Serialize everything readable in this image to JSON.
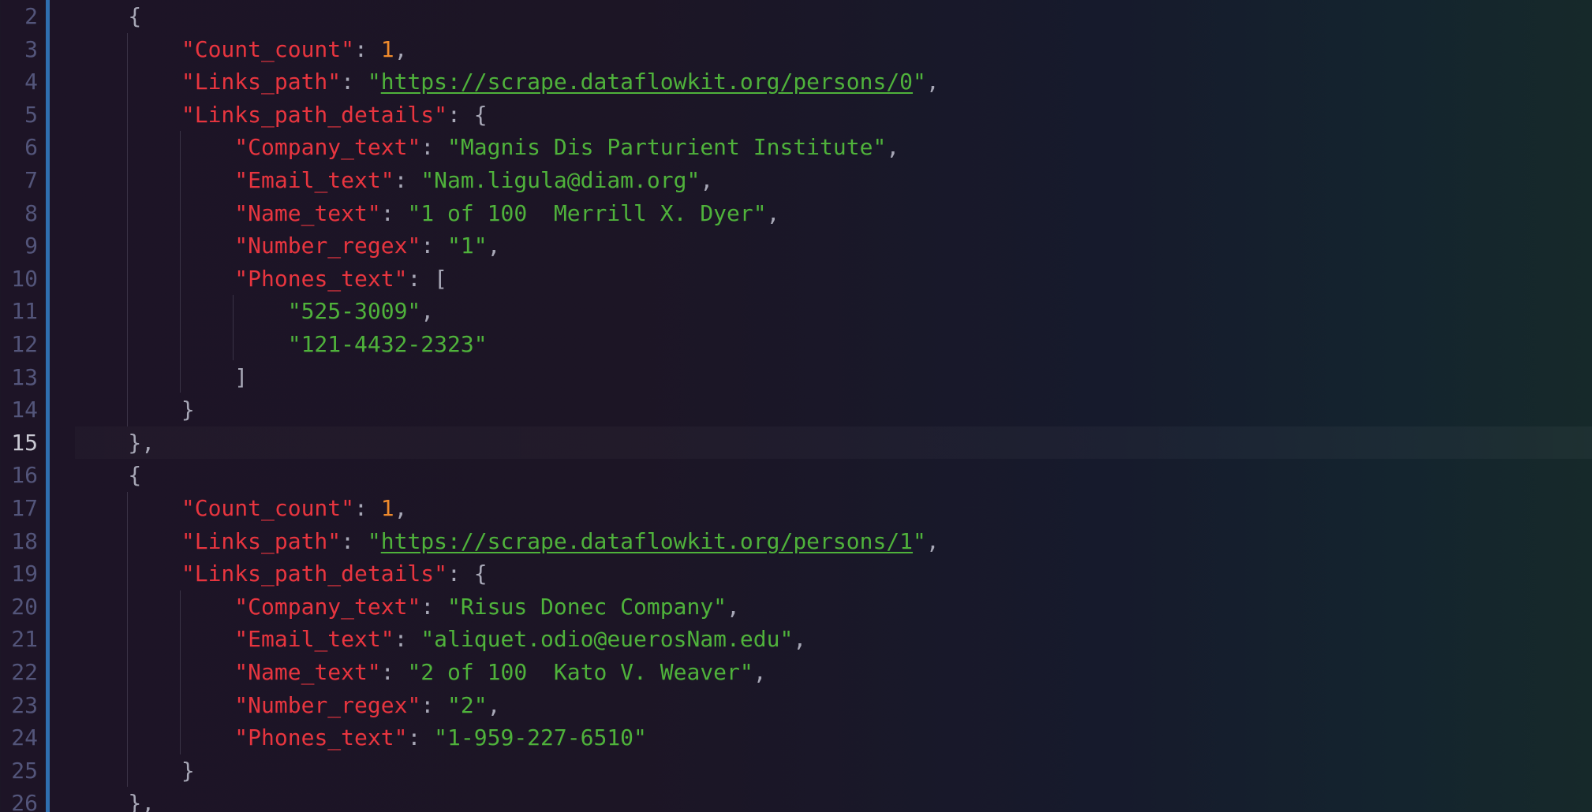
{
  "editor": {
    "line_numbers": [
      "2",
      "3",
      "4",
      "5",
      "6",
      "7",
      "8",
      "9",
      "10",
      "11",
      "12",
      "13",
      "14",
      "15",
      "16",
      "17",
      "18",
      "19",
      "20",
      "21",
      "22",
      "23",
      "24",
      "25",
      "26"
    ],
    "active_line": "15",
    "colors": {
      "key": "#e8353f",
      "string": "#4fb23b",
      "number": "#ef8a2c",
      "punctuation": "#a7a7b6",
      "line_number": "#53557a",
      "gutter_bar": "#2f6fb0"
    },
    "records": [
      {
        "count_key": "\"Count_count\"",
        "count_val": "1",
        "links_key": "\"Links_path\"",
        "links_val": "https://scrape.dataflowkit.org/persons/0",
        "details_key": "\"Links_path_details\"",
        "company_key": "\"Company_text\"",
        "company_val": "\"Magnis Dis Parturient Institute\"",
        "email_key": "\"Email_text\"",
        "email_val": "\"Nam.ligula@diam.org\"",
        "name_key": "\"Name_text\"",
        "name_val": "\"1 of 100  Merrill X. Dyer\"",
        "number_key": "\"Number_regex\"",
        "number_val": "\"1\"",
        "phones_key": "\"Phones_text\"",
        "phones": [
          "\"525-3009\"",
          "\"121-4432-2323\""
        ]
      },
      {
        "count_key": "\"Count_count\"",
        "count_val": "1",
        "links_key": "\"Links_path\"",
        "links_val": "https://scrape.dataflowkit.org/persons/1",
        "details_key": "\"Links_path_details\"",
        "company_key": "\"Company_text\"",
        "company_val": "\"Risus Donec Company\"",
        "email_key": "\"Email_text\"",
        "email_val": "\"aliquet.odio@euerosNam.edu\"",
        "name_key": "\"Name_text\"",
        "name_val": "\"2 of 100  Kato V. Weaver\"",
        "number_key": "\"Number_regex\"",
        "number_val": "\"2\"",
        "phones_key": "\"Phones_text\"",
        "phones_val": "\"1-959-227-6510\""
      }
    ]
  }
}
